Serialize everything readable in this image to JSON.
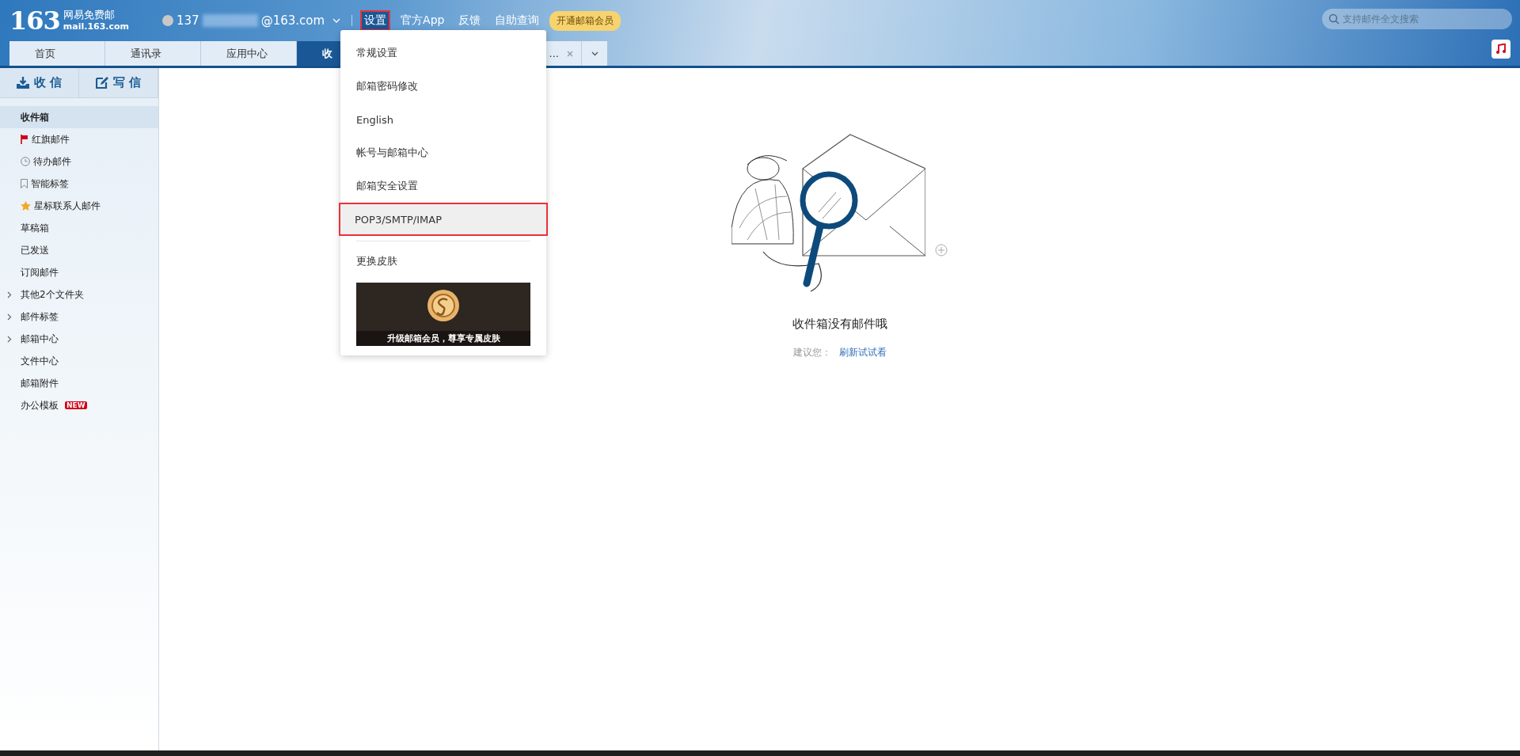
{
  "header": {
    "logo_number": "163",
    "logo_title": "网易免费邮",
    "logo_domain": "mail.163.com",
    "account_prefix": "137",
    "account_suffix": "@163.com",
    "nav": [
      {
        "label": "设置",
        "selected": true,
        "highlighted": true
      },
      {
        "label": "官方App",
        "selected": false,
        "highlighted": false
      },
      {
        "label": "反馈",
        "selected": false,
        "highlighted": false
      },
      {
        "label": "自助查询",
        "selected": false,
        "highlighted": false
      }
    ],
    "vip_button": "开通邮箱会员",
    "search": {
      "placeholder": "支持邮件全文搜索"
    }
  },
  "tabs": [
    {
      "label": "首页",
      "selected": false,
      "closable": false
    },
    {
      "label": "通讯录",
      "selected": false,
      "closable": false
    },
    {
      "label": "应用中心",
      "selected": false,
      "closable": false
    },
    {
      "label": "收",
      "selected": true,
      "closable": false
    },
    {
      "label": "...",
      "selected": false,
      "closable": true
    }
  ],
  "sidebar": {
    "buttons": [
      {
        "label": "收 信",
        "kind": "receive"
      },
      {
        "label": "写 信",
        "kind": "compose"
      }
    ],
    "folders": [
      {
        "label": "收件箱",
        "kind": "plain",
        "selected": true
      },
      {
        "label": "红旗邮件",
        "kind": "flag",
        "selected": false
      },
      {
        "label": "待办邮件",
        "kind": "clock",
        "selected": false
      },
      {
        "label": "智能标签",
        "kind": "bookmark",
        "selected": false
      },
      {
        "label": "星标联系人邮件",
        "kind": "star",
        "selected": false
      },
      {
        "label": "草稿箱",
        "kind": "plain",
        "selected": false
      },
      {
        "label": "已发送",
        "kind": "plain",
        "selected": false
      },
      {
        "label": "订阅邮件",
        "kind": "plain",
        "selected": false
      },
      {
        "label": "其他2个文件夹",
        "kind": "group",
        "selected": false,
        "expanded": false
      },
      {
        "label": "邮件标签",
        "kind": "group",
        "selected": false,
        "expanded": false
      },
      {
        "label": "邮箱中心",
        "kind": "group",
        "selected": false,
        "expanded": false
      },
      {
        "label": "文件中心",
        "kind": "plain",
        "selected": false
      },
      {
        "label": "邮箱附件",
        "kind": "plain",
        "selected": false
      },
      {
        "label": "办公模板",
        "kind": "plain",
        "selected": false,
        "badge": "NEW"
      }
    ]
  },
  "settings_menu": {
    "items": [
      {
        "label": "常规设置",
        "highlighted": false
      },
      {
        "label": "邮箱密码修改",
        "highlighted": false
      },
      {
        "label": "English",
        "highlighted": false
      },
      {
        "label": "帐号与邮箱中心",
        "highlighted": false
      },
      {
        "label": "邮箱安全设置",
        "highlighted": false
      },
      {
        "label": "POP3/SMTP/IMAP",
        "highlighted": true
      }
    ],
    "skin_item": "更换皮肤",
    "promo": "升级邮箱会员，尊享专属皮肤"
  },
  "empty_state": {
    "title": "收件箱没有邮件哦",
    "hint": "建议您：",
    "link": "刷新试试看"
  }
}
